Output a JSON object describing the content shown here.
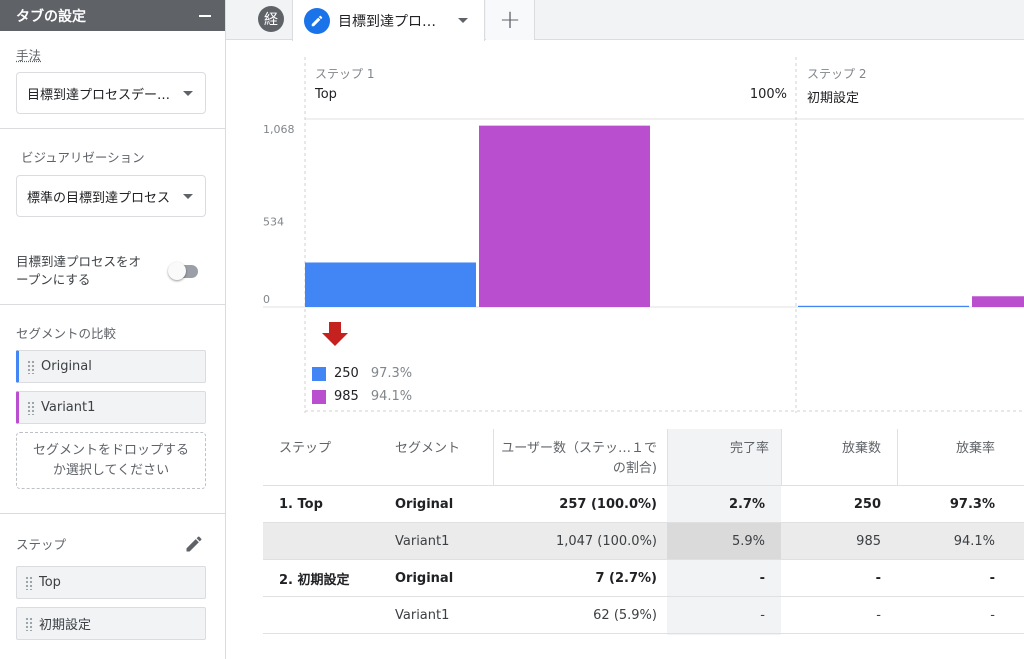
{
  "sidebar": {
    "title": "タブの設定",
    "technique_label": "手法",
    "technique_value": "目標到達プロセスデー…",
    "visualization_label": "ビジュアリゼーション",
    "visualization_value": "標準の目標到達プロセス",
    "open_funnel_label": "目標到達プロセスをオープンにする",
    "open_funnel_on": false,
    "segment_compare_label": "セグメントの比較",
    "segments": [
      {
        "label": "Original",
        "color": "#4285f4"
      },
      {
        "label": "Variant1",
        "color": "#b94fce"
      }
    ],
    "drop_hint": "セグメントをドロップするか選択してください",
    "steps_label": "ステップ",
    "steps": [
      "Top",
      "初期設定"
    ]
  },
  "tabs": {
    "summary_glyph": "経",
    "active_label": "目標到達プロ…",
    "add_label": "+"
  },
  "chart_data": {
    "type": "bar",
    "y_ticks": [
      "1,068",
      "534",
      "0"
    ],
    "ylim": [
      0,
      1068
    ],
    "steps": [
      {
        "name": "ステップ 1",
        "label": "Top",
        "percent": "100%"
      },
      {
        "name": "ステップ 2",
        "label": "初期設定",
        "percent": ""
      }
    ],
    "series": [
      {
        "name": "Original",
        "color": "#4285f4",
        "values": [
          257,
          7
        ]
      },
      {
        "name": "Variant1",
        "color": "#b94fce",
        "values": [
          1047,
          62
        ]
      }
    ],
    "abandonment": [
      {
        "color": "#4285f4",
        "count": "250",
        "rate": "97.3%"
      },
      {
        "color": "#b94fce",
        "count": "985",
        "rate": "94.1%"
      }
    ]
  },
  "table": {
    "headers": [
      "ステップ",
      "セグメント",
      "ユーザー数（ステッ…１での割合)",
      "完了率",
      "放棄数",
      "放棄率"
    ],
    "rows": [
      {
        "step": "1. Top",
        "segment": "Original",
        "users": "257 (100.0%)",
        "completion": "2.7%",
        "abandon": "250",
        "abandon_rate": "97.3%",
        "bold": true
      },
      {
        "step": "",
        "segment": "Variant1",
        "users": "1,047 (100.0%)",
        "completion": "5.9%",
        "abandon": "985",
        "abandon_rate": "94.1%",
        "bold": false
      },
      {
        "step": "2. 初期設定",
        "segment": "Original",
        "users": "7 (2.7%)",
        "completion": "-",
        "abandon": "-",
        "abandon_rate": "-",
        "bold": true
      },
      {
        "step": "",
        "segment": "Variant1",
        "users": "62 (5.9%)",
        "completion": "-",
        "abandon": "-",
        "abandon_rate": "-",
        "bold": false
      }
    ]
  }
}
